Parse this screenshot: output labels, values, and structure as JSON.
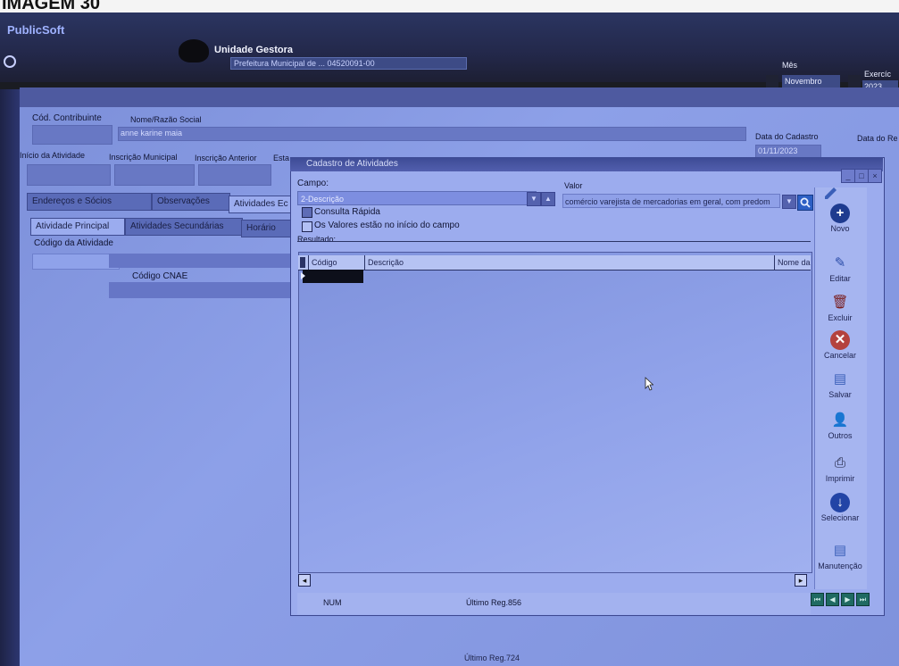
{
  "photo_label": "IMAGEM 30",
  "header": {
    "brand": "PublicSoft",
    "unit_title": "Unidade Gestora",
    "unit_sub": "Prefeitura Municipal de ... 04520091-00",
    "month_label": "Mês",
    "month_value": "Novembro",
    "year_label": "Exercíc",
    "year_value": "2023"
  },
  "main_form": {
    "cod_contribuinte_label": "Cód. Contribuinte",
    "nome_label": "Nome/Razão Social",
    "nome_value": "anne karine maia",
    "data_cadastro_label": "Data do Cadastro",
    "data_cadastro_value": "01/11/2023",
    "data_re_label": "Data do Re",
    "inicio_label": "Início da Atividade",
    "inscricao_label": "Inscrição Municipal",
    "inscricao_anterior_label": "Inscrição Anterior",
    "estado_label": "Esta",
    "tabs": [
      "Endereços e Sócios",
      "Observações",
      "Atividades Ec"
    ],
    "subtabs": [
      "Atividade Principal",
      "Atividades Secundárias",
      "Horário"
    ],
    "codigo_atividade_label": "Código da Atividade",
    "codigo_cnae_label": "Código CNAE",
    "status_ultimo": "Último Reg.724"
  },
  "modal": {
    "title": "Cadastro de Atividades",
    "campo_label": "Campo:",
    "campo_value": "2-Descrição",
    "valor_label": "Valor",
    "valor_value": "comércio varejista de mercadorias em geral, com predom",
    "consulta_rapida_label": "Consulta Rápida",
    "consulta_rapida_checked": true,
    "inicio_campo_label": "Os Valores estão no início do campo",
    "inicio_campo_checked": false,
    "resultado_label": "Resultado:",
    "columns": [
      "Código",
      "Descrição",
      "Nome da"
    ],
    "status_num": "NUM",
    "status_ultimo": "Último Reg.856"
  },
  "toolbar": [
    {
      "label": "Novo",
      "icon": "plus-circle-icon",
      "color": "#1e3b8f"
    },
    {
      "label": "Editar",
      "icon": "pencil-icon",
      "color": "#2a4ca8"
    },
    {
      "label": "Excluir",
      "icon": "trash-icon",
      "color": "#7a1d1d"
    },
    {
      "label": "Cancelar",
      "icon": "cancel-icon",
      "color": "#b4423e"
    },
    {
      "label": "Salvar",
      "icon": "save-icon",
      "color": "#3a5fb8"
    },
    {
      "label": "Outros",
      "icon": "user-search-icon",
      "color": "#2d2d6a"
    },
    {
      "label": "Imprimir",
      "icon": "printer-icon",
      "color": "#1a1d3a"
    },
    {
      "label": "Selecionar",
      "icon": "select-down-icon",
      "color": "#2244a6"
    },
    {
      "label": "Manutenção",
      "icon": "maintenance-icon",
      "color": "#3a5fb8"
    }
  ],
  "colors": {
    "background_blue": "#8c9fe6",
    "dark_header": "#23284a",
    "nav_button": "#1f6a62"
  }
}
